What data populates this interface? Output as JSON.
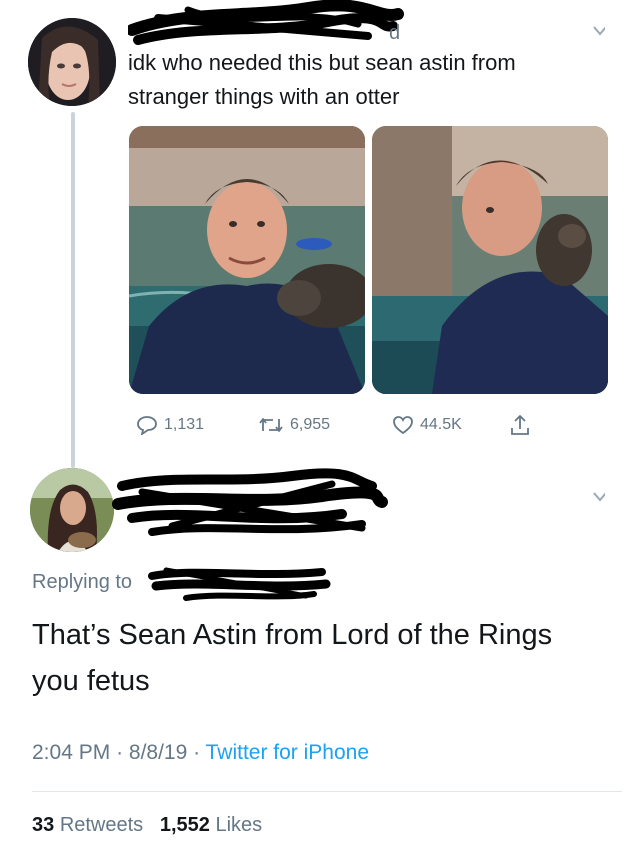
{
  "tweet": {
    "author_visible_fragment": "d",
    "text_line1": "idk who needed this but sean astin from",
    "text_line2": "stranger things with an otter",
    "replies": "1,131",
    "retweets": "6,955",
    "likes": "44.5K"
  },
  "reply": {
    "replying_to": "Replying to",
    "text_line1": "That’s Sean Astin from Lord of the Rings",
    "text_line2": "you fetus",
    "time": "2:04 PM",
    "date": "8/8/19",
    "source": "Twitter for iPhone",
    "retweet_count": "33",
    "retweet_label": "Retweets",
    "like_count": "1,552",
    "like_label": "Likes"
  },
  "colors": {
    "text": "#14171a",
    "secondary": "#657786",
    "link": "#1da1f2",
    "thread_line": "#c9d4dc"
  },
  "icons": [
    "reply-icon",
    "retweet-icon",
    "heart-icon",
    "share-icon",
    "chevron-down-icon"
  ]
}
